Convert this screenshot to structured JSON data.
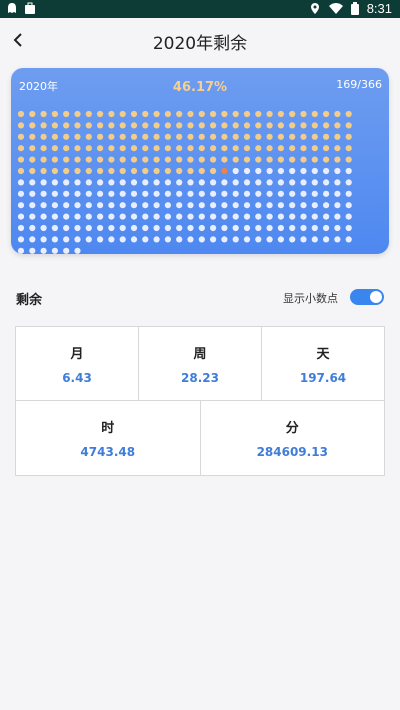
{
  "status_bar": {
    "time": "8:31",
    "icons": [
      "ghost-icon",
      "bag-icon",
      "location-icon",
      "wifi-icon",
      "battery-icon"
    ]
  },
  "header": {
    "title": "2020年剩余",
    "back_icon": "chevron-left-icon"
  },
  "year_card": {
    "year": "2020年",
    "percent": "46.17%",
    "count": "169/366",
    "days_total": 366,
    "days_elapsed": 169,
    "columns": 30,
    "colors": {
      "elapsed": "#f3cc88",
      "today": "#e8834a",
      "remaining": "#e8eefc",
      "background": "#4e88f0"
    }
  },
  "remain": {
    "label": "剩余",
    "decimal_toggle_label": "显示小数点",
    "decimal_toggle_on": true
  },
  "stats": [
    {
      "label": "月",
      "value": "6.43"
    },
    {
      "label": "周",
      "value": "28.23"
    },
    {
      "label": "天",
      "value": "197.64"
    },
    {
      "label": "时",
      "value": "4743.48"
    },
    {
      "label": "分",
      "value": "284609.13"
    }
  ],
  "colors": {
    "accent": "#3a86ef",
    "value_text": "#3f7dd8"
  }
}
